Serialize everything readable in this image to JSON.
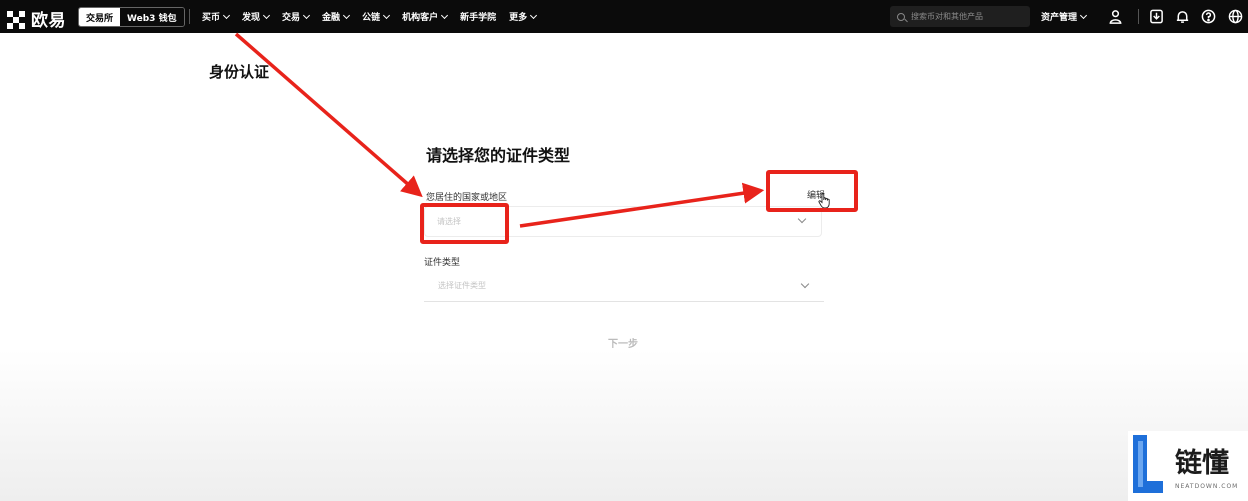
{
  "header": {
    "brand": "欧易",
    "segments": [
      "交易所",
      "Web3 钱包"
    ],
    "nav": [
      "买币",
      "发现",
      "交易",
      "金融",
      "公链",
      "机构客户",
      "新手学院",
      "更多"
    ],
    "nav_has_dropdown": [
      true,
      true,
      true,
      true,
      true,
      true,
      false,
      true
    ],
    "search_placeholder": "搜索币对和其他产品",
    "asset_menu": "资产管理",
    "icons": [
      "user-icon",
      "download-icon",
      "bell-icon",
      "help-icon",
      "globe-icon"
    ]
  },
  "page": {
    "title": "身份认证",
    "form_title": "请选择您的证件类型",
    "country_label": "您居住的国家或地区",
    "country_placeholder": "请选择",
    "edit_link": "编辑",
    "doc_label": "证件类型",
    "doc_placeholder": "选择证件类型",
    "next_button": "下一步"
  },
  "watermark": {
    "brand": "链懂",
    "subtitle": "NEATDOWN.COM"
  },
  "colors": {
    "topbar_bg": "#0b0b0b",
    "annotation_red": "#e8231b",
    "watermark_blue": "#1e6fd9"
  }
}
